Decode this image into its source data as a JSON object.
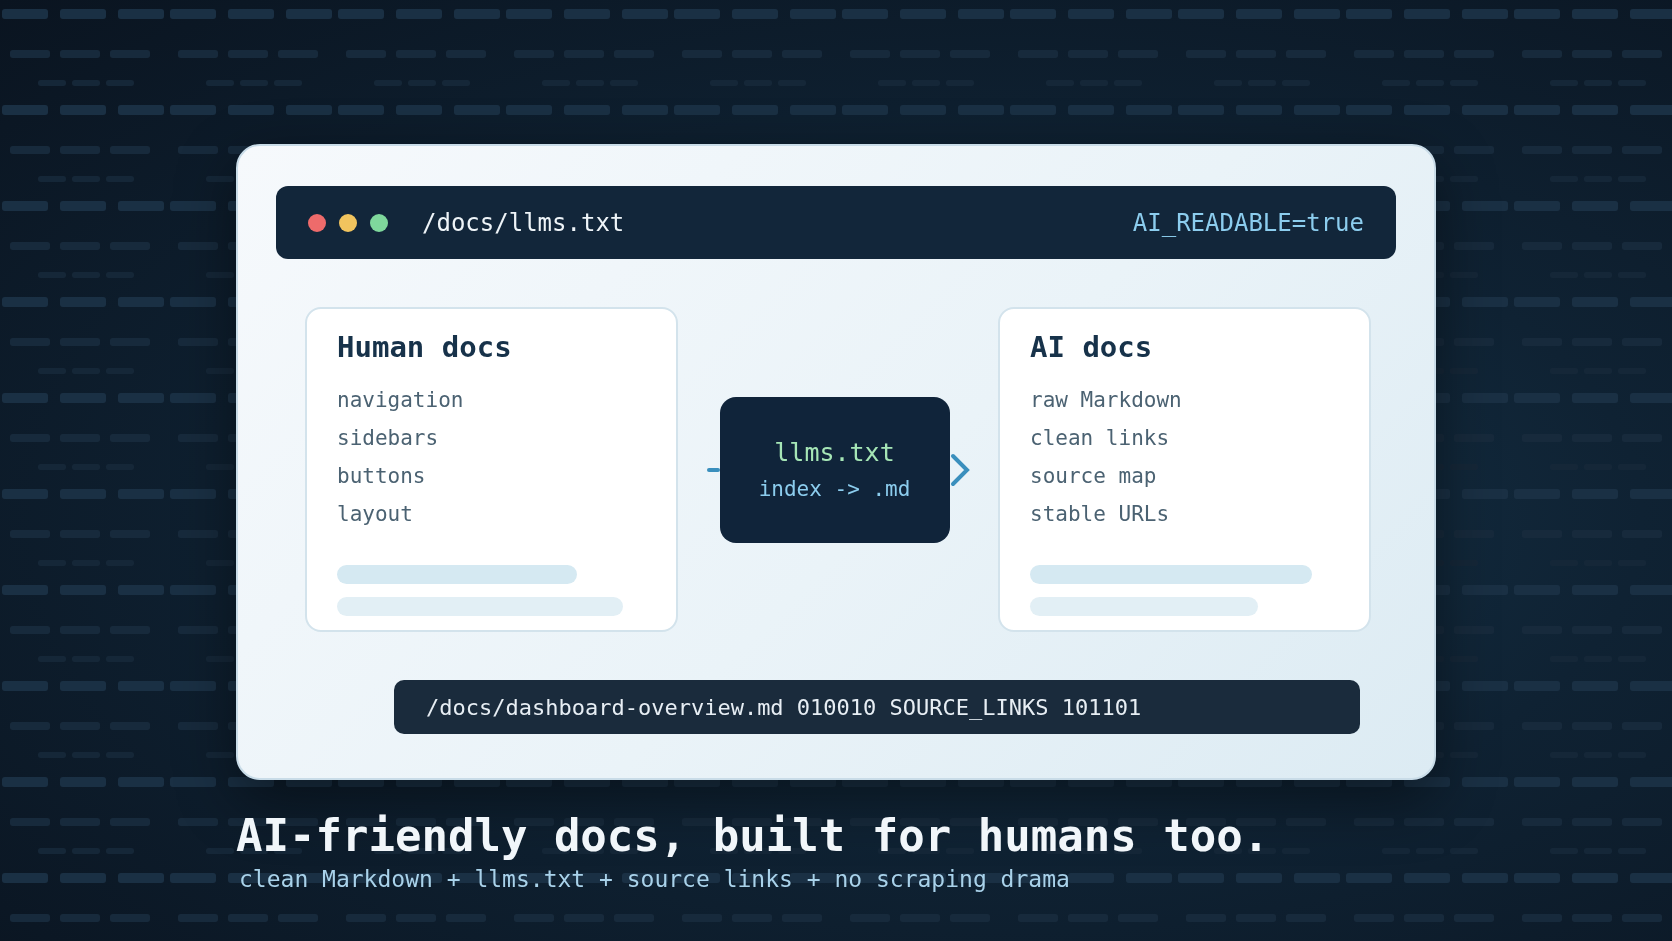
{
  "window": {
    "path": "/docs/llms.txt",
    "flag": "AI_READABLE=true"
  },
  "panels": [
    {
      "title": "Human docs",
      "items": [
        "navigation",
        "sidebars",
        "buttons",
        "layout"
      ]
    },
    {
      "title": "AI docs",
      "items": [
        "raw Markdown",
        "clean links",
        "source map",
        "stable URLs"
      ]
    }
  ],
  "bridge": {
    "file": "llms.txt",
    "mapping": "index -> .md"
  },
  "source_bar": "/docs/dashboard-overview.md 010010 SOURCE_LINKS 101101",
  "headline": "AI-friendly docs, built for humans too.",
  "subline": "clean Markdown + llms.txt + source links + no scraping drama"
}
